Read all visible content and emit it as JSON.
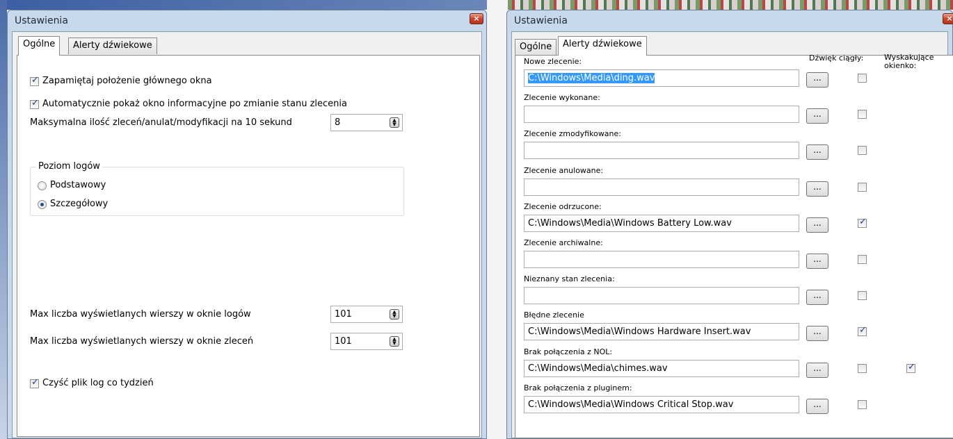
{
  "left_window": {
    "title": "Ustawienia",
    "close_glyph": "×",
    "tabs": [
      {
        "label": "Ogólne",
        "active": true
      },
      {
        "label": "Alerty dźwiekowe",
        "active": false
      }
    ],
    "general": {
      "remember_position": {
        "label": "Zapamiętaj położenie głównego okna",
        "checked": true
      },
      "auto_show_info": {
        "label": "Automatycznie pokaż okno informacyjne po zmianie stanu zlecenia",
        "checked": true
      },
      "max_orders": {
        "label": "Maksymalna ilość zleceń/anulat/modyfikacji na 10 sekund",
        "value": "8"
      },
      "log_level": {
        "title": "Poziom logów",
        "options": [
          {
            "label": "Podstawowy",
            "selected": false
          },
          {
            "label": "Szczegółowy",
            "selected": true
          }
        ]
      },
      "max_log_rows": {
        "label": "Max liczba wyświetlanych wierszy w oknie logów",
        "value": "101"
      },
      "max_order_rows": {
        "label": "Max liczba wyświetlanych wierszy w oknie zleceń",
        "value": "101"
      },
      "clear_log": {
        "label": "Czyść plik log co tydzień",
        "checked": true
      }
    }
  },
  "right_window": {
    "title": "Ustawienia",
    "close_glyph": "×",
    "tabs": [
      {
        "label": "Ogólne",
        "active": false
      },
      {
        "label": "Alerty dźwiekowe",
        "active": true
      }
    ],
    "columns": {
      "continuous": "Dźwięk ciągły:",
      "popup": "Wyskakujące okienko:"
    },
    "browse_label": "...",
    "alerts": [
      {
        "label": "Nowe zlecenie:",
        "path": "C:\\Windows\\Media\\ding.wav",
        "selected": true,
        "continuous": false,
        "popup": null
      },
      {
        "label": "Zlecenie wykonane:",
        "path": "",
        "continuous": false,
        "popup": null
      },
      {
        "label": "Zlecenie zmodyfikowane:",
        "path": "",
        "continuous": false,
        "popup": null
      },
      {
        "label": "Zlecenie anulowane:",
        "path": "",
        "continuous": false,
        "popup": null
      },
      {
        "label": "Zlecenie odrzucone:",
        "path": "C:\\Windows\\Media\\Windows Battery Low.wav",
        "continuous": true,
        "popup": null
      },
      {
        "label": "Zlecenie archiwalne:",
        "path": "",
        "continuous": false,
        "popup": null
      },
      {
        "label": "Nieznany stan zlecenia:",
        "path": "",
        "continuous": false,
        "popup": null
      },
      {
        "label": "Błędne zlecenie",
        "path": "C:\\Windows\\Media\\Windows Hardware Insert.wav",
        "continuous": true,
        "popup": null
      },
      {
        "label": "Brak połączenia z NOL:",
        "path": "C:\\Windows\\Media\\chimes.wav",
        "continuous": false,
        "popup": true
      },
      {
        "label": "Brak połączenia z pluginem:",
        "path": "C:\\Windows\\Media\\Windows Critical Stop.wav",
        "continuous": false,
        "popup": null
      }
    ]
  }
}
